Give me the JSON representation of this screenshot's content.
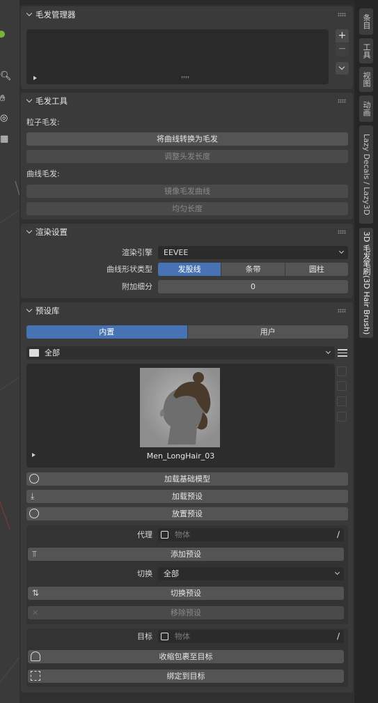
{
  "hair_manager": {
    "title": "毛发管理器"
  },
  "hair_tools": {
    "title": "毛发工具",
    "particle_label": "粒子毛发:",
    "convert_curves_btn": "将曲线转换为毛发",
    "adjust_length_btn": "调整头发长度",
    "curve_label": "曲线毛发:",
    "mirror_btn": "镜像毛发曲线",
    "even_length_btn": "均匀长度"
  },
  "render_settings": {
    "title": "渲染设置",
    "engine_label": "渲染引擎",
    "engine_value": "EEVEE",
    "curve_shape_label": "曲线形状类型",
    "shape_options": [
      "发股线",
      "条带",
      "圆柱"
    ],
    "shape_selected": 0,
    "subdiv_label": "附加细分",
    "subdiv_value": "0"
  },
  "preset_library": {
    "title": "预设库",
    "tabs": [
      "内置",
      "用户"
    ],
    "tab_selected": 0,
    "category_value": "全部",
    "preset_name": "Men_LongHair_03",
    "load_base_btn": "加载基础模型",
    "load_preset_btn": "加载预设",
    "place_preset_btn": "放置预设",
    "proxy_label": "代理",
    "proxy_placeholder": "物体",
    "add_preset_btn": "添加预设",
    "switch_label": "切换",
    "switch_value": "全部",
    "switch_preset_btn": "切换预设",
    "remove_preset_btn": "移除预设",
    "target_label": "目标",
    "target_placeholder": "物体",
    "shrinkwrap_btn": "收缩包裹至目标",
    "bind_btn": "绑定到目标"
  },
  "side_tabs": [
    "条目",
    "工具",
    "视图",
    "动画",
    "Lazy Decals / Lazy3D",
    "3D 毛发笔刷(3D Hair Brush)"
  ],
  "colors": {
    "accent": "#4772b3",
    "panel": "#3a3a3a",
    "button": "#545454"
  }
}
